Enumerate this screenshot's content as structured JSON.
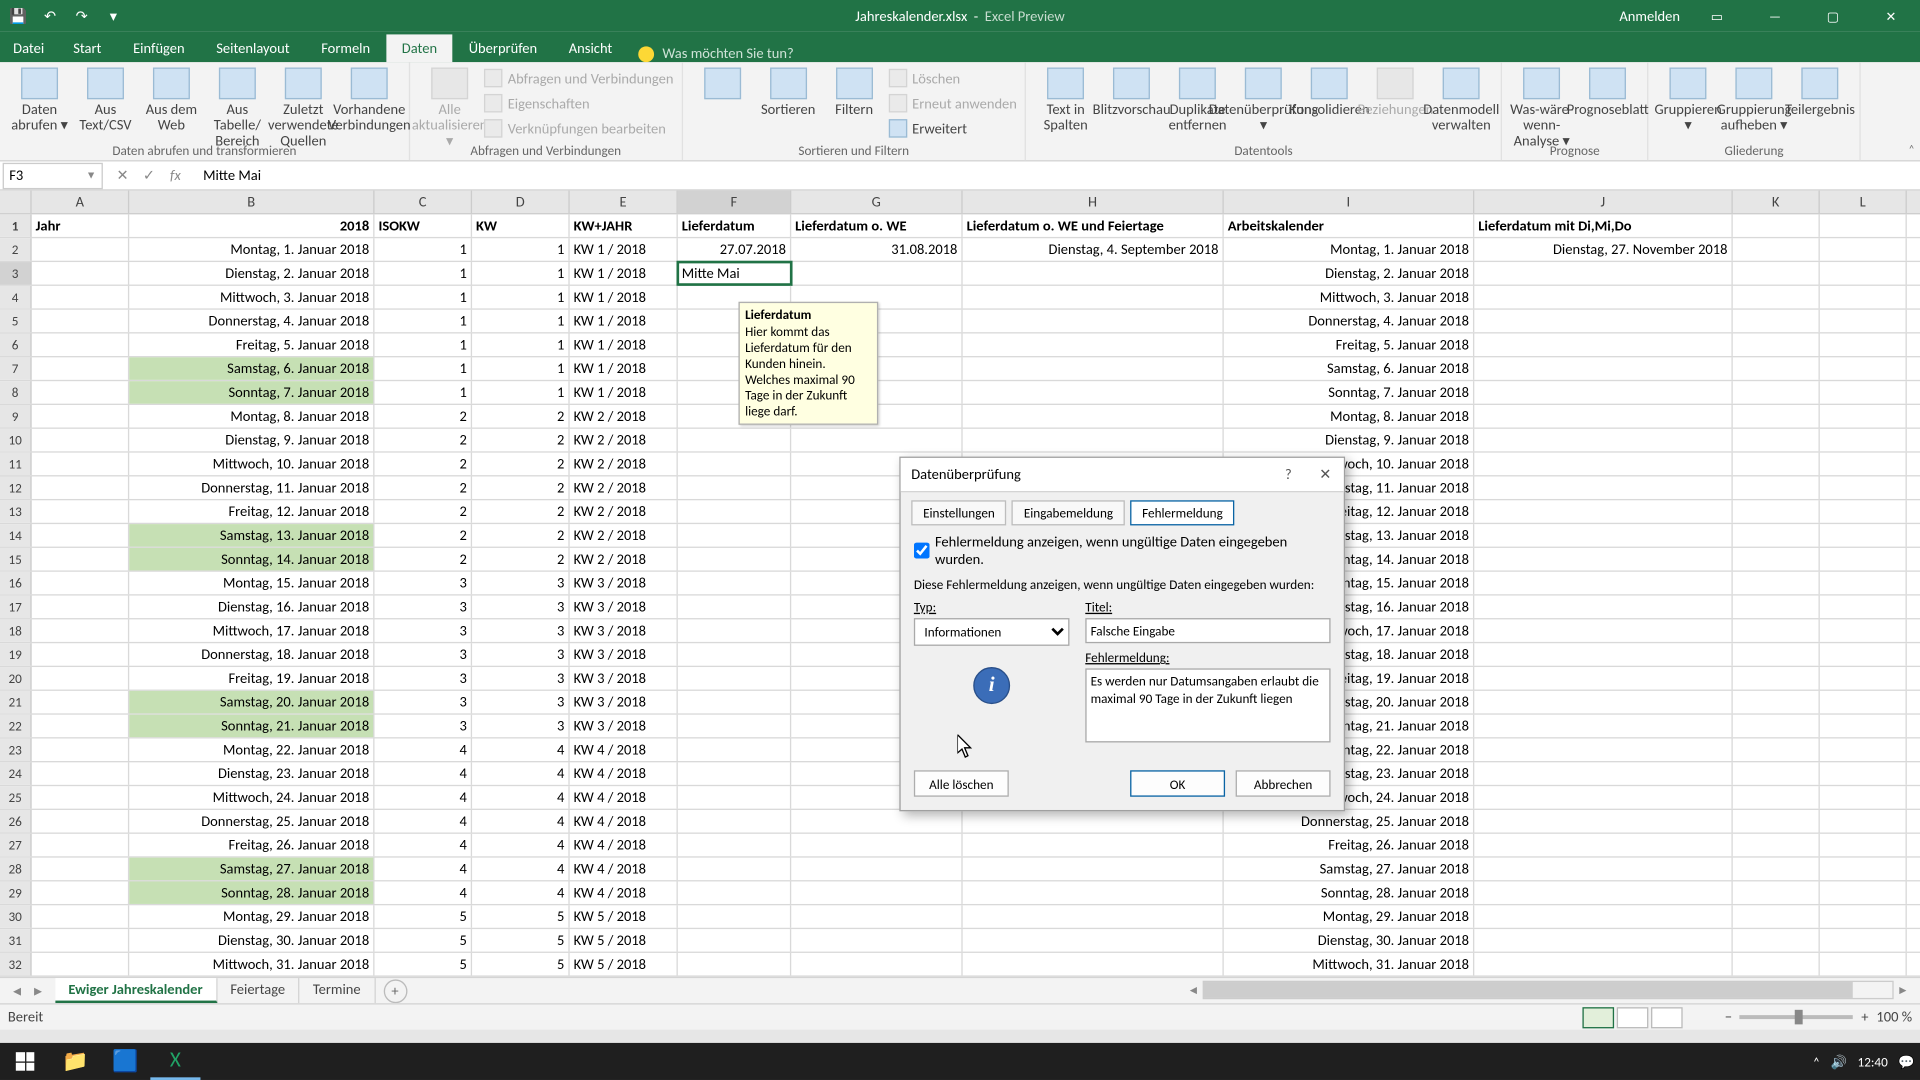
{
  "app": {
    "title": "Jahreskalender.xlsx",
    "subtitle": "Excel Preview",
    "signin": "Anmelden"
  },
  "tabs": [
    "Datei",
    "Start",
    "Einfügen",
    "Seitenlayout",
    "Formeln",
    "Daten",
    "Überprüfen",
    "Ansicht"
  ],
  "tabs_active_index": 5,
  "tellme_placeholder": "Was möchten Sie tun?",
  "ribbon": {
    "g1": {
      "label": "Daten abrufen und transformieren",
      "btns": [
        "Daten abrufen ▾",
        "Aus Text/CSV",
        "Aus dem Web",
        "Aus Tabelle/ Bereich",
        "Zuletzt verwendete Quellen",
        "Vorhandene Verbindungen"
      ]
    },
    "g2": {
      "label": "Abfragen und Verbindungen",
      "big": "Alle aktualisieren ▾",
      "lines": [
        "Abfragen und Verbindungen",
        "Eigenschaften",
        "Verknüpfungen bearbeiten"
      ]
    },
    "g3": {
      "label": "Sortieren und Filtern",
      "btns": [
        "Sortieren",
        "Filtern"
      ],
      "lines": [
        "Löschen",
        "Erneut anwenden",
        "Erweitert"
      ]
    },
    "g4": {
      "label": "Datentools",
      "btns": [
        "Text in Spalten",
        "Blitzvorschau",
        "Duplikate entfernen",
        "Datenüberprüfung ▾",
        "Konsolidieren",
        "Beziehungen",
        "Datenmodell verwalten"
      ]
    },
    "g5": {
      "label": "Prognose",
      "btns": [
        "Was-wäre-wenn-Analyse ▾",
        "Prognoseblatt"
      ]
    },
    "g6": {
      "label": "Gliederung",
      "btns": [
        "Gruppieren ▾",
        "Gruppierung aufheben ▾",
        "Teilergebnis"
      ]
    }
  },
  "fbar": {
    "name": "F3",
    "value": "Mitte Mai"
  },
  "cols": [
    "A",
    "B",
    "C",
    "D",
    "E",
    "F",
    "G",
    "H",
    "I",
    "J",
    "K",
    "L"
  ],
  "headers": {
    "A": "Jahr",
    "B": "",
    "C": "ISOKW",
    "D": "KW",
    "E": "KW+JAHR",
    "F": "Lieferdatum",
    "G": "Lieferdatum o. WE",
    "H": "Lieferdatum o. WE und Feiertage",
    "I": "Arbeitskalender",
    "J": "Lieferdatum mit Di,Mi,Do"
  },
  "year": "2018",
  "rows": [
    {
      "n": 2,
      "b": "Montag, 1. Januar 2018",
      "c": "1",
      "d": "1",
      "e": "KW 1 / 2018",
      "f": "27.07.2018",
      "g": "31.08.2018",
      "h": "Dienstag, 4. September 2018",
      "i": "Montag, 1. Januar 2018",
      "j": "Dienstag, 27. November 2018",
      "hl": false
    },
    {
      "n": 3,
      "b": "Dienstag, 2. Januar 2018",
      "c": "1",
      "d": "1",
      "e": "KW 1 / 2018",
      "f": "Mitte Mai",
      "g": "",
      "h": "",
      "i": "Dienstag, 2. Januar 2018",
      "j": "",
      "hl": false,
      "sel": true
    },
    {
      "n": 4,
      "b": "Mittwoch, 3. Januar 2018",
      "c": "1",
      "d": "1",
      "e": "KW 1 / 2018",
      "f": "",
      "g": "",
      "h": "",
      "i": "Mittwoch, 3. Januar 2018",
      "j": "",
      "hl": false
    },
    {
      "n": 5,
      "b": "Donnerstag, 4. Januar 2018",
      "c": "1",
      "d": "1",
      "e": "KW 1 / 2018",
      "f": "",
      "g": "",
      "h": "",
      "i": "Donnerstag, 4. Januar 2018",
      "j": "",
      "hl": false
    },
    {
      "n": 6,
      "b": "Freitag, 5. Januar 2018",
      "c": "1",
      "d": "1",
      "e": "KW 1 / 2018",
      "f": "",
      "g": "",
      "h": "",
      "i": "Freitag, 5. Januar 2018",
      "j": "",
      "hl": false
    },
    {
      "n": 7,
      "b": "Samstag, 6. Januar 2018",
      "c": "1",
      "d": "1",
      "e": "KW 1 / 2018",
      "f": "",
      "g": "",
      "h": "",
      "i": "Samstag, 6. Januar 2018",
      "j": "",
      "hl": true
    },
    {
      "n": 8,
      "b": "Sonntag, 7. Januar 2018",
      "c": "1",
      "d": "1",
      "e": "KW 1 / 2018",
      "f": "",
      "g": "",
      "h": "",
      "i": "Sonntag, 7. Januar 2018",
      "j": "",
      "hl": true
    },
    {
      "n": 9,
      "b": "Montag, 8. Januar 2018",
      "c": "2",
      "d": "2",
      "e": "KW 2 / 2018",
      "f": "",
      "g": "",
      "h": "",
      "i": "Montag, 8. Januar 2018",
      "j": "",
      "hl": false
    },
    {
      "n": 10,
      "b": "Dienstag, 9. Januar 2018",
      "c": "2",
      "d": "2",
      "e": "KW 2 / 2018",
      "f": "",
      "g": "",
      "h": "",
      "i": "Dienstag, 9. Januar 2018",
      "j": "",
      "hl": false
    },
    {
      "n": 11,
      "b": "Mittwoch, 10. Januar 2018",
      "c": "2",
      "d": "2",
      "e": "KW 2 / 2018",
      "f": "",
      "g": "",
      "h": "",
      "i": "Mittwoch, 10. Januar 2018",
      "j": "",
      "hl": false
    },
    {
      "n": 12,
      "b": "Donnerstag, 11. Januar 2018",
      "c": "2",
      "d": "2",
      "e": "KW 2 / 2018",
      "f": "",
      "g": "",
      "h": "",
      "i": "Donnerstag, 11. Januar 2018",
      "j": "",
      "hl": false
    },
    {
      "n": 13,
      "b": "Freitag, 12. Januar 2018",
      "c": "2",
      "d": "2",
      "e": "KW 2 / 2018",
      "f": "",
      "g": "",
      "h": "",
      "i": "Freitag, 12. Januar 2018",
      "j": "",
      "hl": false
    },
    {
      "n": 14,
      "b": "Samstag, 13. Januar 2018",
      "c": "2",
      "d": "2",
      "e": "KW 2 / 2018",
      "f": "",
      "g": "",
      "h": "",
      "i": "Samstag, 13. Januar 2018",
      "j": "",
      "hl": true
    },
    {
      "n": 15,
      "b": "Sonntag, 14. Januar 2018",
      "c": "2",
      "d": "2",
      "e": "KW 2 / 2018",
      "f": "",
      "g": "",
      "h": "",
      "i": "Sonntag, 14. Januar 2018",
      "j": "",
      "hl": true
    },
    {
      "n": 16,
      "b": "Montag, 15. Januar 2018",
      "c": "3",
      "d": "3",
      "e": "KW 3 / 2018",
      "f": "",
      "g": "",
      "h": "",
      "i": "Montag, 15. Januar 2018",
      "j": "",
      "hl": false
    },
    {
      "n": 17,
      "b": "Dienstag, 16. Januar 2018",
      "c": "3",
      "d": "3",
      "e": "KW 3 / 2018",
      "f": "",
      "g": "",
      "h": "",
      "i": "Dienstag, 16. Januar 2018",
      "j": "",
      "hl": false
    },
    {
      "n": 18,
      "b": "Mittwoch, 17. Januar 2018",
      "c": "3",
      "d": "3",
      "e": "KW 3 / 2018",
      "f": "",
      "g": "",
      "h": "",
      "i": "Mittwoch, 17. Januar 2018",
      "j": "",
      "hl": false
    },
    {
      "n": 19,
      "b": "Donnerstag, 18. Januar 2018",
      "c": "3",
      "d": "3",
      "e": "KW 3 / 2018",
      "f": "",
      "g": "",
      "h": "",
      "i": "Donnerstag, 18. Januar 2018",
      "j": "",
      "hl": false
    },
    {
      "n": 20,
      "b": "Freitag, 19. Januar 2018",
      "c": "3",
      "d": "3",
      "e": "KW 3 / 2018",
      "f": "",
      "g": "",
      "h": "",
      "i": "Freitag, 19. Januar 2018",
      "j": "",
      "hl": false
    },
    {
      "n": 21,
      "b": "Samstag, 20. Januar 2018",
      "c": "3",
      "d": "3",
      "e": "KW 3 / 2018",
      "f": "",
      "g": "",
      "h": "",
      "i": "Samstag, 20. Januar 2018",
      "j": "",
      "hl": true
    },
    {
      "n": 22,
      "b": "Sonntag, 21. Januar 2018",
      "c": "3",
      "d": "3",
      "e": "KW 3 / 2018",
      "f": "",
      "g": "",
      "h": "",
      "i": "Sonntag, 21. Januar 2018",
      "j": "",
      "hl": true
    },
    {
      "n": 23,
      "b": "Montag, 22. Januar 2018",
      "c": "4",
      "d": "4",
      "e": "KW 4 / 2018",
      "f": "",
      "g": "",
      "h": "",
      "i": "Montag, 22. Januar 2018",
      "j": "",
      "hl": false
    },
    {
      "n": 24,
      "b": "Dienstag, 23. Januar 2018",
      "c": "4",
      "d": "4",
      "e": "KW 4 / 2018",
      "f": "",
      "g": "",
      "h": "",
      "i": "Dienstag, 23. Januar 2018",
      "j": "",
      "hl": false
    },
    {
      "n": 25,
      "b": "Mittwoch, 24. Januar 2018",
      "c": "4",
      "d": "4",
      "e": "KW 4 / 2018",
      "f": "",
      "g": "",
      "h": "",
      "i": "Mittwoch, 24. Januar 2018",
      "j": "",
      "hl": false
    },
    {
      "n": 26,
      "b": "Donnerstag, 25. Januar 2018",
      "c": "4",
      "d": "4",
      "e": "KW 4 / 2018",
      "f": "",
      "g": "",
      "h": "",
      "i": "Donnerstag, 25. Januar 2018",
      "j": "",
      "hl": false
    },
    {
      "n": 27,
      "b": "Freitag, 26. Januar 2018",
      "c": "4",
      "d": "4",
      "e": "KW 4 / 2018",
      "f": "",
      "g": "",
      "h": "",
      "i": "Freitag, 26. Januar 2018",
      "j": "",
      "hl": false
    },
    {
      "n": 28,
      "b": "Samstag, 27. Januar 2018",
      "c": "4",
      "d": "4",
      "e": "KW 4 / 2018",
      "f": "",
      "g": "",
      "h": "",
      "i": "Samstag, 27. Januar 2018",
      "j": "",
      "hl": true
    },
    {
      "n": 29,
      "b": "Sonntag, 28. Januar 2018",
      "c": "4",
      "d": "4",
      "e": "KW 4 / 2018",
      "f": "",
      "g": "",
      "h": "",
      "i": "Sonntag, 28. Januar 2018",
      "j": "",
      "hl": true
    },
    {
      "n": 30,
      "b": "Montag, 29. Januar 2018",
      "c": "5",
      "d": "5",
      "e": "KW 5 / 2018",
      "f": "",
      "g": "",
      "h": "",
      "i": "Montag, 29. Januar 2018",
      "j": "",
      "hl": false
    },
    {
      "n": 31,
      "b": "Dienstag, 30. Januar 2018",
      "c": "5",
      "d": "5",
      "e": "KW 5 / 2018",
      "f": "",
      "g": "",
      "h": "",
      "i": "Dienstag, 30. Januar 2018",
      "j": "",
      "hl": false
    },
    {
      "n": 32,
      "b": "Mittwoch, 31. Januar 2018",
      "c": "5",
      "d": "5",
      "e": "KW 5 / 2018",
      "f": "",
      "g": "",
      "h": "",
      "i": "Mittwoch, 31. Januar 2018",
      "j": "",
      "hl": false
    }
  ],
  "tooltip": {
    "title": "Lieferdatum",
    "body": "Hier kommt das Lieferdatum für den Kunden hinein. Welches maximal 90 Tage in der Zukunft liege darf."
  },
  "dialog": {
    "title": "Datenüberprüfung",
    "tabs": [
      "Einstellungen",
      "Eingabemeldung",
      "Fehlermeldung"
    ],
    "active_tab": 2,
    "show_error_label": "Fehlermeldung anzeigen, wenn ungültige Daten eingegeben wurden.",
    "show_error_checked": true,
    "subheader": "Diese Fehlermeldung anzeigen, wenn ungültige Daten eingegeben wurden:",
    "type_label": "Typ:",
    "type_value": "Informationen",
    "title_label": "Titel:",
    "title_value": "Falsche Eingabe",
    "msg_label": "Fehlermeldung:",
    "msg_value": "Es werden nur Datumsangaben erlaubt die maximal 90 Tage in der Zukunft liegen",
    "btn_clear": "Alle löschen",
    "btn_ok": "OK",
    "btn_cancel": "Abbrechen"
  },
  "sheets": [
    "Ewiger Jahreskalender",
    "Feiertage",
    "Termine"
  ],
  "sheets_active": 0,
  "status": {
    "ready": "Bereit",
    "zoom": "100 %"
  },
  "taskbar": {
    "time": "12:40"
  }
}
